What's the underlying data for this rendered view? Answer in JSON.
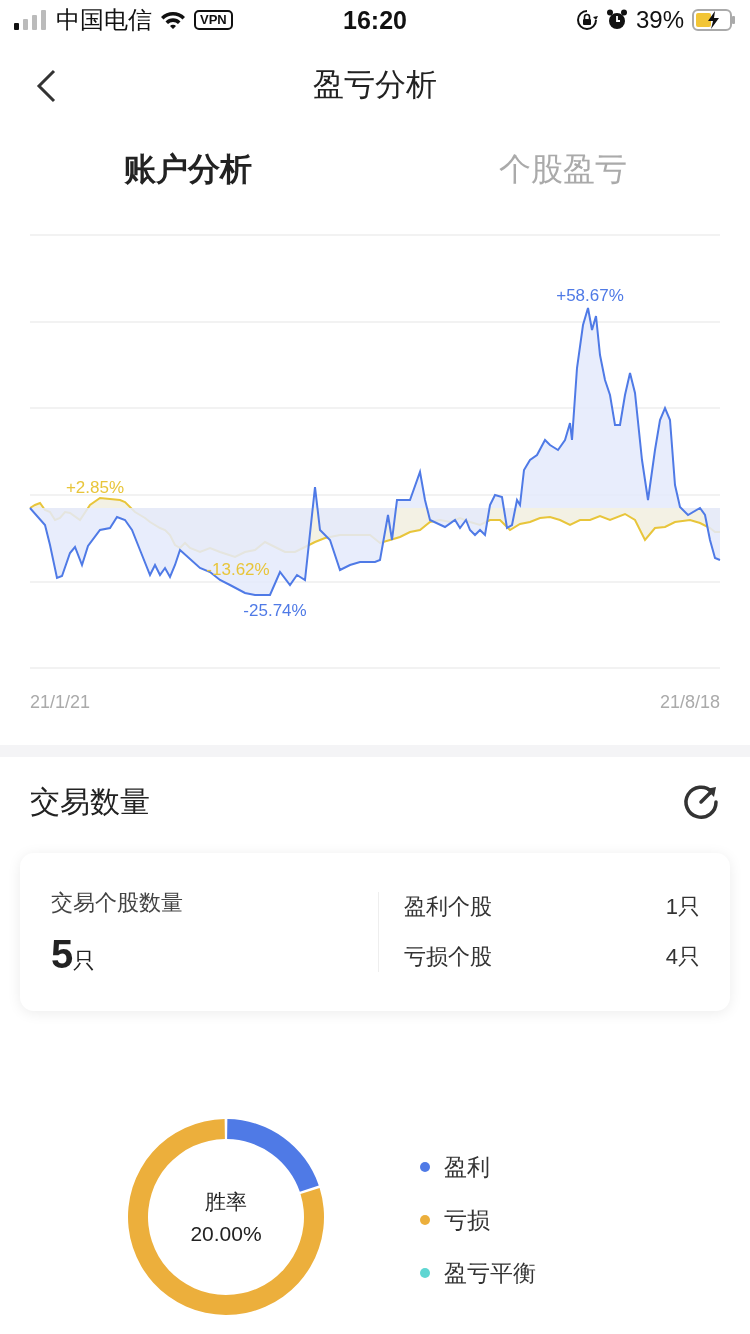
{
  "status_bar": {
    "carrier": "中国电信",
    "vpn": "VPN",
    "time": "16:20",
    "battery": "39%"
  },
  "nav": {
    "title": "盈亏分析"
  },
  "tabs": [
    {
      "label": "账户分析",
      "selected": true
    },
    {
      "label": "个股盈亏",
      "selected": false
    }
  ],
  "chart": {
    "annotations": [
      {
        "text": "+58.67%",
        "color": "#4f7ae6"
      },
      {
        "text": "+2.85%",
        "color": "#e8c53a"
      },
      {
        "text": "-13.62%",
        "color": "#e8c53a"
      },
      {
        "text": "-25.74%",
        "color": "#4f7ae6"
      }
    ],
    "x_start": "21/1/21",
    "x_end": "21/8/18"
  },
  "trades": {
    "title": "交易数量",
    "total_label": "交易个股数量",
    "total_value": "5",
    "total_unit": "只",
    "rows": [
      {
        "label": "盈利个股",
        "value": "1只"
      },
      {
        "label": "亏损个股",
        "value": "4只"
      }
    ]
  },
  "win_rate": {
    "label": "胜率",
    "value": "20.00%",
    "legend": [
      {
        "color": "#4f7ae6"
      },
      {
        "color": "#ecaf3c"
      },
      {
        "color": "#5fd6d2"
      }
    ],
    "chart_data": {
      "type": "donut",
      "categories": [
        "盈利",
        "亏损",
        "盈亏平衡"
      ],
      "values": [
        20,
        80,
        0
      ]
    }
  }
}
